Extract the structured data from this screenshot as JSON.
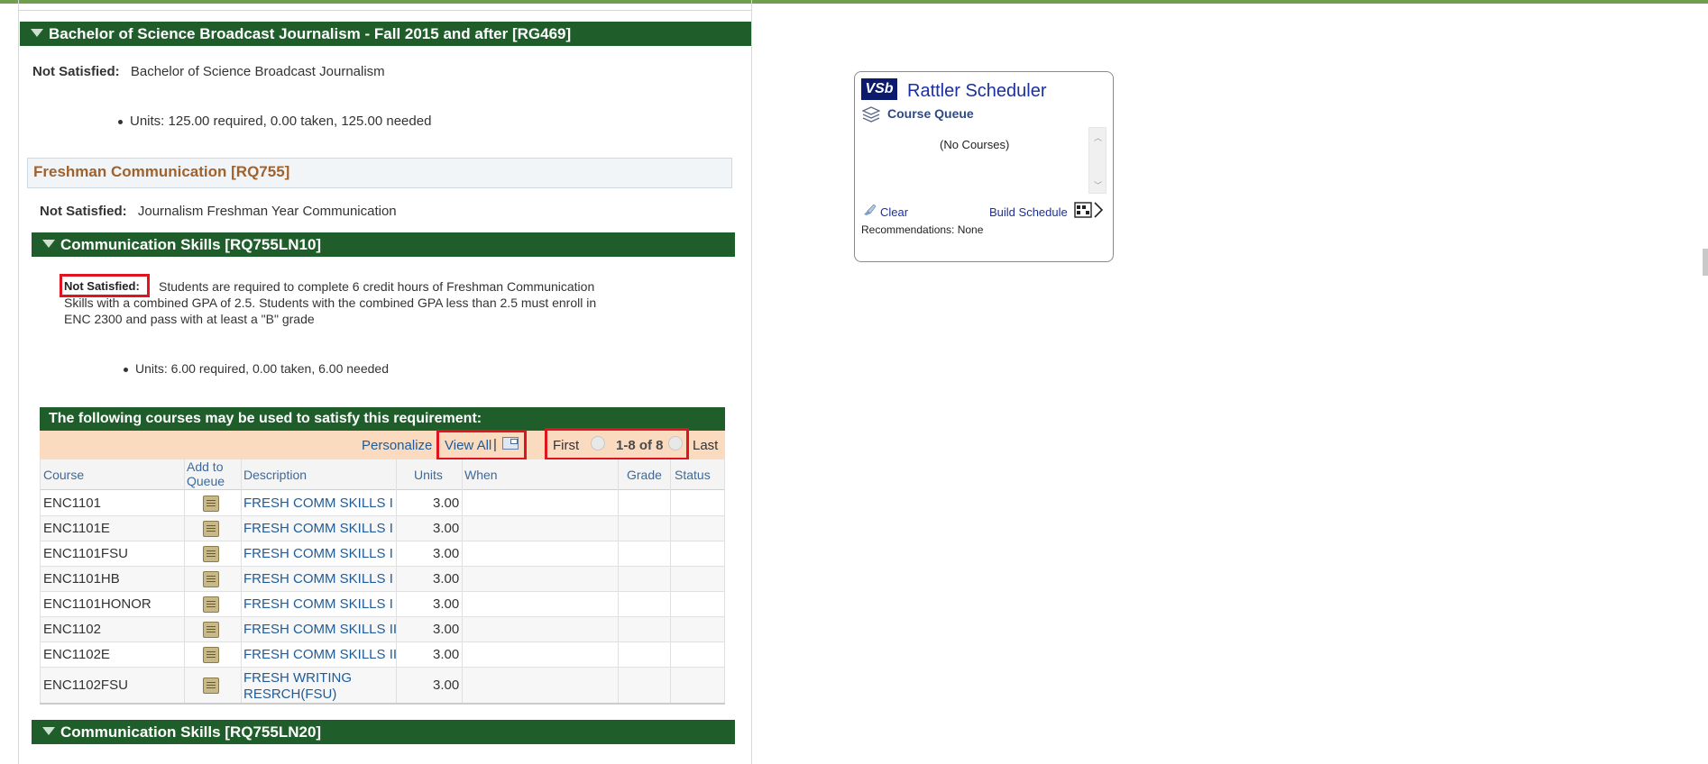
{
  "program": {
    "header": "Bachelor of Science Broadcast Journalism - Fall 2015 and after [RG469]",
    "status_label": "Not Satisfied:",
    "status_text": "Bachelor of Science Broadcast Journalism",
    "units": "Units: 125.00 required, 0.00 taken, 125.00 needed"
  },
  "requirement": {
    "title": "Freshman Communication [RQ755]",
    "status_label": "Not Satisfied:",
    "status_text": "Journalism Freshman Year Communication"
  },
  "subreq1": {
    "header": "Communication Skills [RQ755LN10]",
    "status_label": "Not Satisfied:",
    "desc_line1": "Students are required to complete 6 credit hours of Freshman Communication",
    "desc_line2": "Skills with a combined GPA of 2.5. Students with the combined GPA less than 2.5 must enroll in",
    "desc_line3": "ENC 2300 and pass with at least a \"B\" grade",
    "units": "Units: 6.00 required, 0.00 taken, 6.00 needed"
  },
  "courses_grid": {
    "title": "The following courses may be used to satisfy this requirement:",
    "personalize": "Personalize",
    "view_all": "View All",
    "separator": "|",
    "first": "First",
    "range": "1-8 of 8",
    "last": "Last",
    "columns": {
      "course": "Course",
      "add_line1": "Add to",
      "add_line2": "Queue",
      "description": "Description",
      "units": "Units",
      "when": "When",
      "grade": "Grade",
      "status": "Status"
    },
    "rows": [
      {
        "course": "ENC1101",
        "description": "FRESH COMM SKILLS I",
        "units": "3.00"
      },
      {
        "course": "ENC1101E",
        "description": "FRESH COMM SKILLS I",
        "units": "3.00"
      },
      {
        "course": "ENC1101FSU",
        "description": "FRESH COMM SKILLS I",
        "units": "3.00"
      },
      {
        "course": "ENC1101HB",
        "description": "FRESH COMM SKILLS I",
        "units": "3.00"
      },
      {
        "course": "ENC1101HONOR",
        "description": "FRESH COMM SKILLS I",
        "units": "3.00"
      },
      {
        "course": "ENC1102",
        "description": "FRESH COMM SKILLS II",
        "units": "3.00"
      },
      {
        "course": "ENC1102E",
        "description": "FRESH COMM SKILLS II",
        "units": "3.00"
      },
      {
        "course": "ENC1102FSU",
        "description_line1": "FRESH WRITING",
        "description_line2": "RESRCH(FSU)",
        "units": "3.00"
      }
    ]
  },
  "subreq2": {
    "header": "Communication Skills [RQ755LN20]"
  },
  "scheduler": {
    "logo": "VSb",
    "title": "Rattler Scheduler",
    "queue_label": "Course Queue",
    "empty": "(No Courses)",
    "clear": "Clear",
    "build": "Build Schedule",
    "recommendations": "Recommendations: None"
  },
  "colors": {
    "green_bar": "#1f5e2b",
    "section_title": "#a0622d",
    "link": "#1e5b99",
    "highlight": "#e0141e",
    "grid_header": "#fadbc0",
    "scheduler_blue": "#0c1b6e"
  },
  "icons": [
    "collapse-triangle-icon",
    "add-to-queue-icon",
    "popout-grid-icon",
    "prev-arrow-icon",
    "next-arrow-icon",
    "layers-icon",
    "clear-brush-icon",
    "calendar-arrow-icon"
  ]
}
